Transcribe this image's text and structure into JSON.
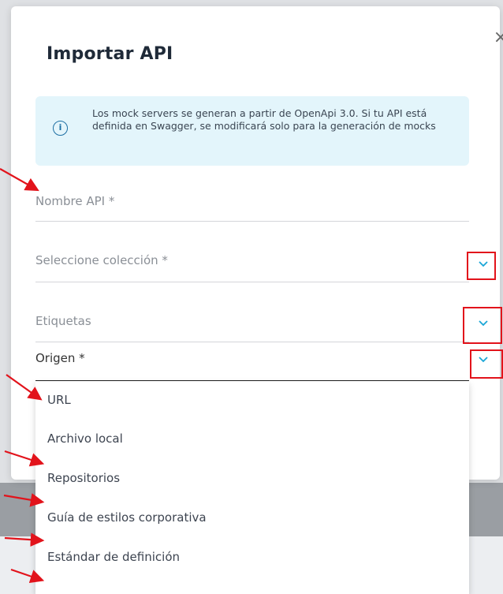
{
  "dialog": {
    "title": "Importar API",
    "close_icon": "close-icon",
    "info": {
      "icon": "info-icon",
      "text": "Los mock servers se generan a partir de OpenApi 3.0. Si tu API está definida en Swagger, se modificará solo para la generación de mocks"
    },
    "fields": {
      "nombre": {
        "label": "Nombre API *"
      },
      "coleccion": {
        "label": "Seleccione colección *"
      },
      "etiquetas": {
        "label": "Etiquetas"
      },
      "origen": {
        "label": "Origen *"
      }
    },
    "origen_options": [
      "URL",
      "Archivo local",
      "Repositorios",
      "Guía de estilos corporativa",
      "Estándar de definición"
    ]
  },
  "colors": {
    "accent": "#1aa6d6",
    "annotation": "#e2131b",
    "info_bg": "#e3f5fb"
  }
}
